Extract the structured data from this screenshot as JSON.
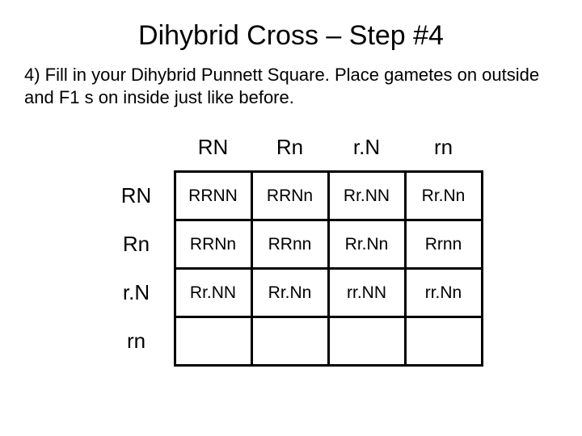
{
  "title": "Dihybrid Cross – Step #4",
  "instruction": "4) Fill in your Dihybrid Punnett Square. Place gametes on outside and F1 s on inside just like before.",
  "col_gametes": [
    "RN",
    "Rn",
    "r.N",
    "rn"
  ],
  "row_gametes": [
    "RN",
    "Rn",
    "r.N",
    "rn"
  ],
  "cells": [
    [
      "RRNN",
      "RRNn",
      "Rr.NN",
      "Rr.Nn"
    ],
    [
      "RRNn",
      "RRnn",
      "Rr.Nn",
      "Rrnn"
    ],
    [
      "Rr.NN",
      "Rr.Nn",
      "rr.NN",
      "rr.Nn"
    ],
    [
      "",
      "",
      "",
      ""
    ]
  ]
}
